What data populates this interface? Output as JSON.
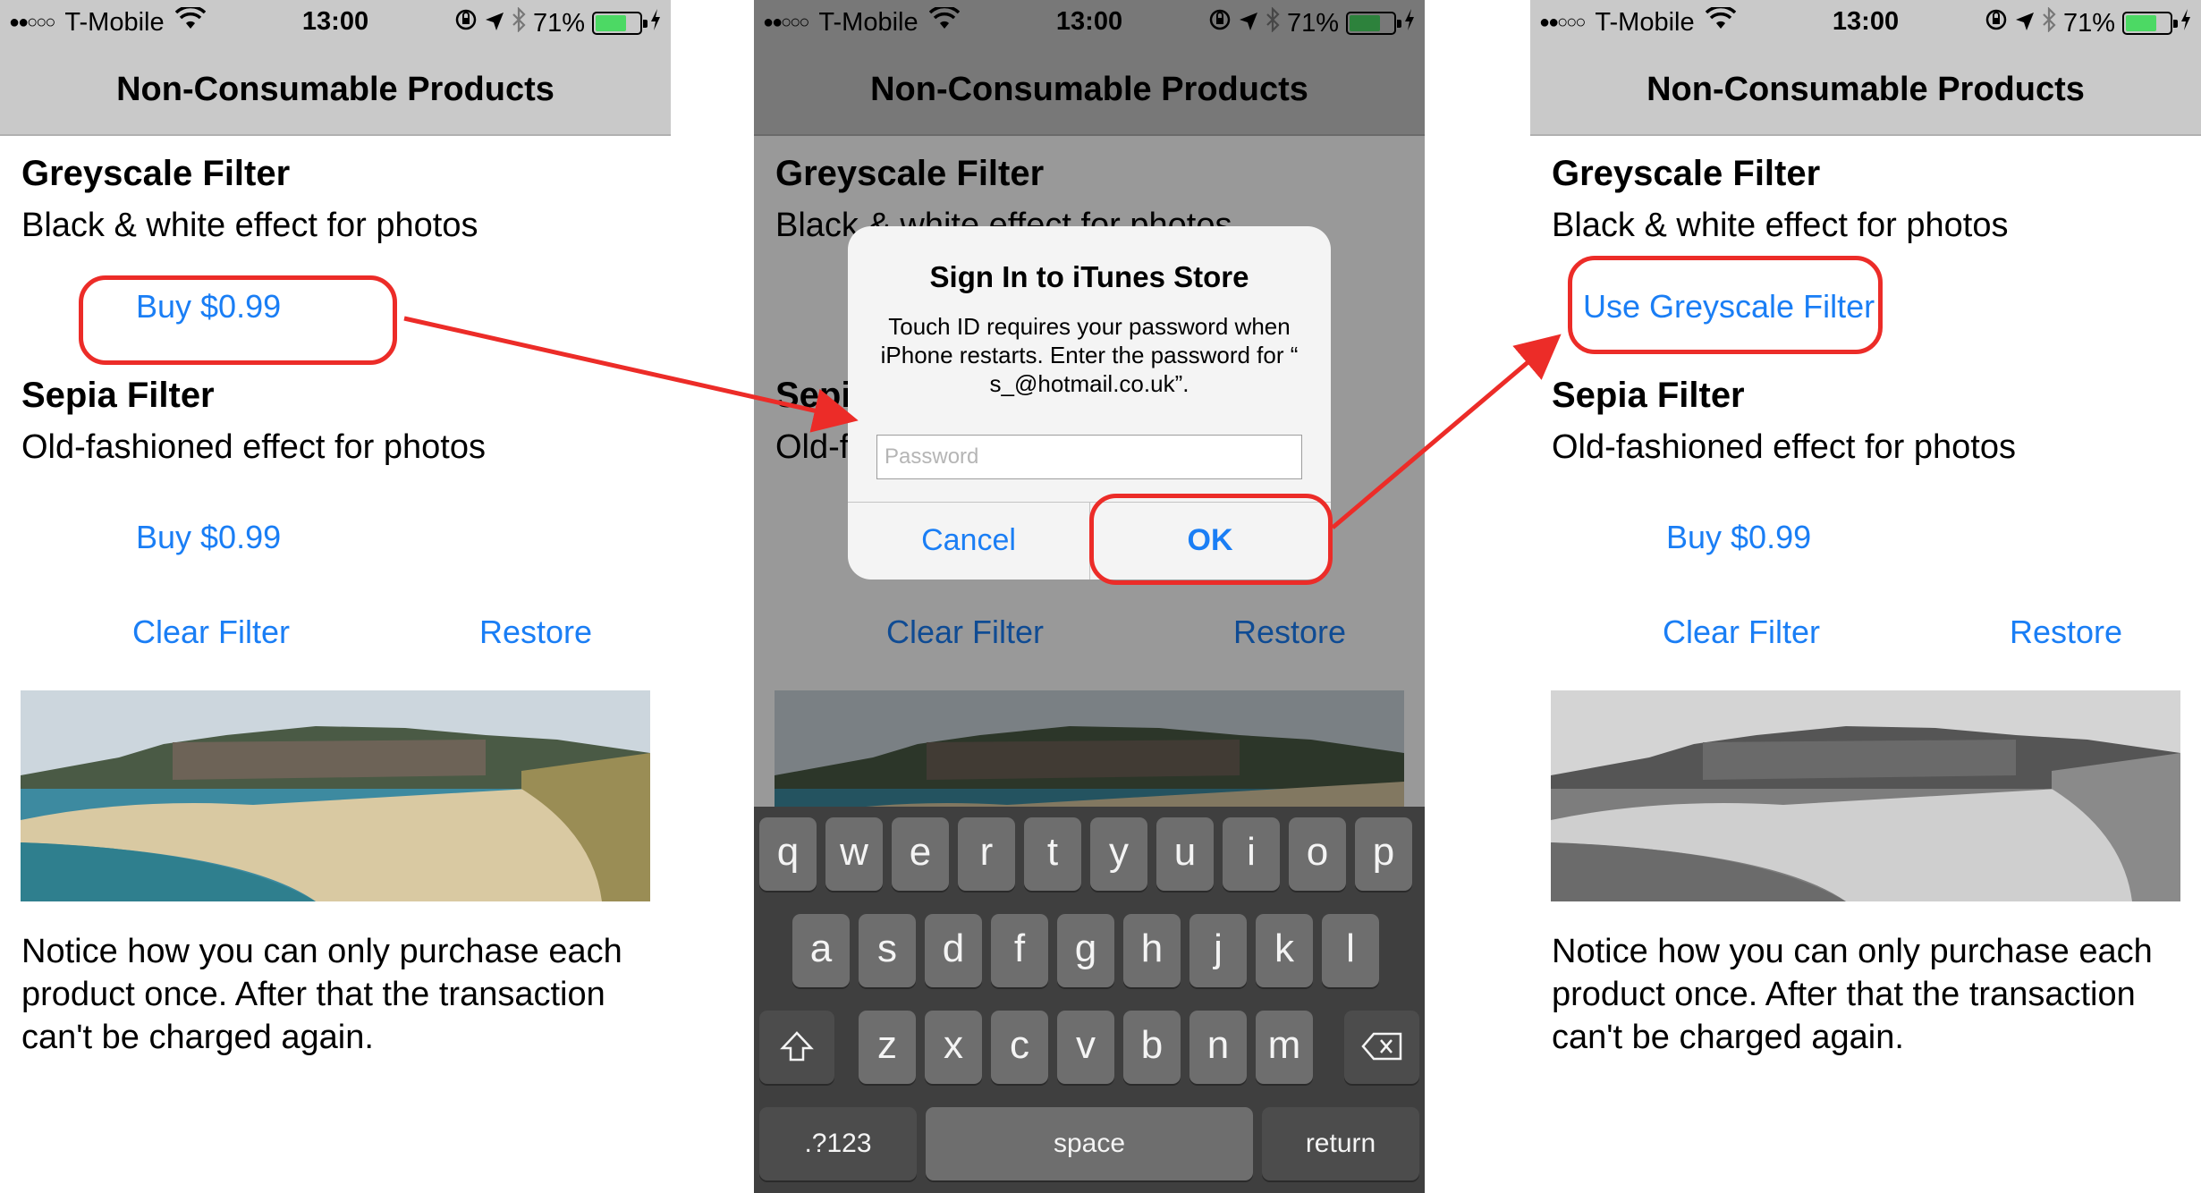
{
  "status_bar": {
    "signal_dots": "●●○○○",
    "carrier": "T-Mobile",
    "time": "13:00",
    "battery": "71%",
    "battery_level": 0.71,
    "wifi_icon": "wifi-icon",
    "icons": [
      "orientation-lock-icon",
      "location-arrow-icon",
      "bluetooth-icon",
      "charging-bolt-icon"
    ]
  },
  "nav_title": "Non-Consumable Products",
  "products": [
    {
      "title": "Greyscale Filter",
      "description": "Black & white effect for photos",
      "buy_label": "Buy $0.99",
      "use_label": "Use Greyscale Filter"
    },
    {
      "title": "Sepia Filter",
      "description": "Old-fashioned effect for photos",
      "buy_label": "Buy $0.99"
    }
  ],
  "actions": {
    "clear_filter": "Clear Filter",
    "restore": "Restore"
  },
  "notice": "Notice how you can only purchase each product once. After that the transaction can't be charged again.",
  "alert": {
    "title": "Sign In to iTunes Store",
    "message": "Touch ID requires your password when iPhone restarts. Enter the password for “            s_@hotmail.co.uk”.",
    "password_placeholder": "Password",
    "cancel": "Cancel",
    "ok": "OK"
  },
  "keyboard": {
    "row1": [
      "q",
      "w",
      "e",
      "r",
      "t",
      "y",
      "u",
      "i",
      "o",
      "p"
    ],
    "row2": [
      "a",
      "s",
      "d",
      "f",
      "g",
      "h",
      "j",
      "k",
      "l"
    ],
    "row3": [
      "z",
      "x",
      "c",
      "v",
      "b",
      "n",
      "m"
    ],
    "numbers": ".?123",
    "space": "space",
    "return": "return"
  },
  "colors": {
    "link": "#1a7ef5",
    "callout": "#ec2c28",
    "nav_bg": "#c9c9c9",
    "battery": "#4cd964"
  }
}
